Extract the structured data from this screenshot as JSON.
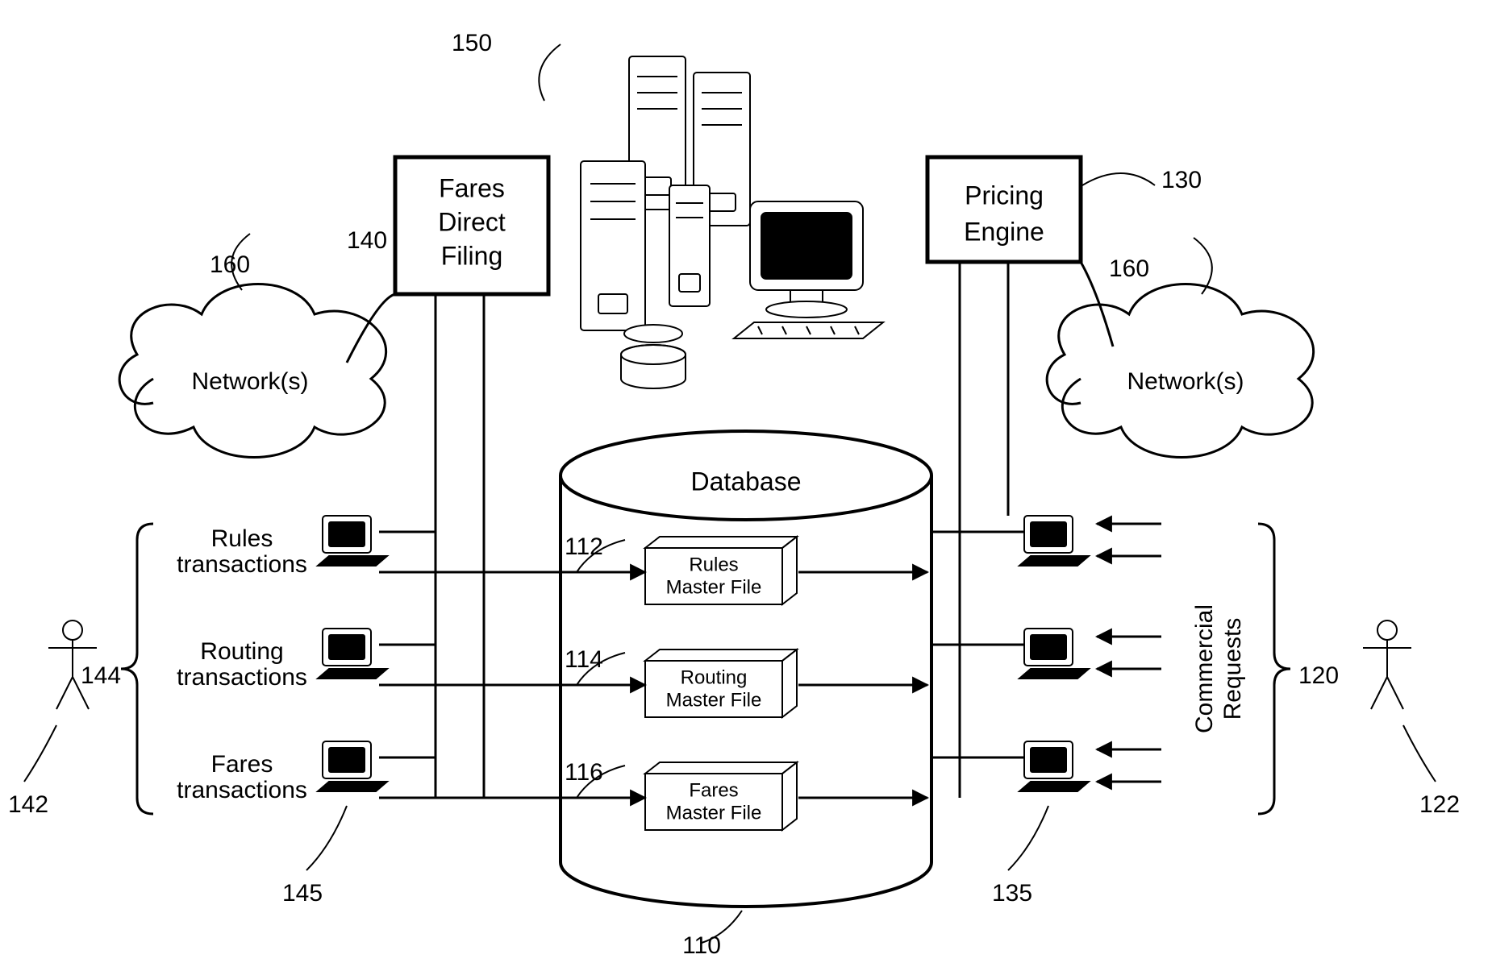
{
  "boxes": {
    "faresDirect": {
      "line1": "Fares",
      "line2": "Direct",
      "line3": "Filing",
      "ref": "140"
    },
    "pricingEngine": {
      "line1": "Pricing",
      "line2": "Engine",
      "ref": "130"
    }
  },
  "clouds": {
    "left": {
      "label": "Network(s)",
      "ref": "160"
    },
    "right": {
      "label": "Network(s)",
      "ref": "160"
    }
  },
  "servers": {
    "ref": "150"
  },
  "database": {
    "title": "Database",
    "ref": "110",
    "files": {
      "rules": {
        "line1": "Rules",
        "line2": "Master File",
        "ref": "112"
      },
      "routing": {
        "line1": "Routing",
        "line2": "Master File",
        "ref": "114"
      },
      "fares": {
        "line1": "Fares",
        "line2": "Master File",
        "ref": "116"
      }
    }
  },
  "leftTransactions": {
    "groupRef": "144",
    "personRef": "142",
    "terminalRef": "145",
    "items": {
      "rules": {
        "line1": "Rules",
        "line2": "transactions"
      },
      "routing": {
        "line1": "Routing",
        "line2": "transactions"
      },
      "fares": {
        "line1": "Fares",
        "line2": "transactions"
      }
    }
  },
  "rightRequests": {
    "groupRef": "120",
    "personRef": "122",
    "terminalRef": "135",
    "label1": "Commercial",
    "label2": "Requests"
  }
}
